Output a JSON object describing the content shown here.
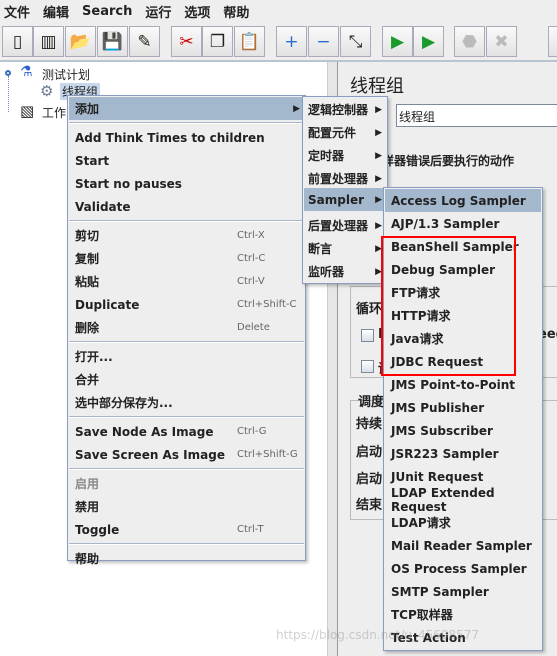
{
  "menubar": [
    "文件",
    "编辑",
    "Search",
    "运行",
    "选项",
    "帮助"
  ],
  "toolbar": [
    {
      "icon": "new-icon",
      "glyph": "▯"
    },
    {
      "icon": "templates-icon",
      "glyph": "▥"
    },
    {
      "icon": "open-icon",
      "glyph": "📂"
    },
    {
      "icon": "save-icon",
      "glyph": "💾"
    },
    {
      "icon": "save-as-icon",
      "glyph": "✎"
    },
    {
      "icon": "cut-icon",
      "glyph": "✂"
    },
    {
      "icon": "copy-icon",
      "glyph": "❐"
    },
    {
      "icon": "paste-icon",
      "glyph": "📋"
    },
    {
      "icon": "expand-icon",
      "glyph": "+"
    },
    {
      "icon": "collapse-icon",
      "glyph": "−"
    },
    {
      "icon": "toggle-icon",
      "glyph": "⤡"
    },
    {
      "icon": "start-icon",
      "glyph": "▶"
    },
    {
      "icon": "start-no-pauses-icon",
      "glyph": "▶"
    },
    {
      "icon": "stop-icon",
      "glyph": "⬣"
    },
    {
      "icon": "shutdown-icon",
      "glyph": "✖"
    }
  ],
  "tree": {
    "root": "测试计划",
    "thread_group": "线程组",
    "workbench": "工作台"
  },
  "right": {
    "title": "线程组",
    "name_value": "线程组",
    "error_action": "样器错误后要执行的动作",
    "loop": "循环",
    "check1": "D",
    "check1_tail": "eed",
    "check2": "调",
    "scheduler": "调度",
    "duration": "持续",
    "startup_delay": "启动",
    "start_time": "启动",
    "end_time": "结束"
  },
  "context_menu": {
    "items": [
      {
        "label": "添加",
        "submenu": true,
        "highlight": true
      },
      {
        "sep": true
      },
      {
        "label": "Add Think Times to children"
      },
      {
        "label": "Start"
      },
      {
        "label": "Start no pauses"
      },
      {
        "label": "Validate"
      },
      {
        "sep": true
      },
      {
        "label": "剪切",
        "shortcut": "Ctrl-X"
      },
      {
        "label": "复制",
        "shortcut": "Ctrl-C"
      },
      {
        "label": "粘贴",
        "shortcut": "Ctrl-V"
      },
      {
        "label": "Duplicate",
        "shortcut": "Ctrl+Shift-C"
      },
      {
        "label": "删除",
        "shortcut": "Delete"
      },
      {
        "sep": true
      },
      {
        "label": "打开..."
      },
      {
        "label": "合并"
      },
      {
        "label": "选中部分保存为..."
      },
      {
        "sep": true
      },
      {
        "label": "Save Node As Image",
        "shortcut": "Ctrl-G"
      },
      {
        "label": "Save Screen As Image",
        "shortcut": "Ctrl+Shift-G"
      },
      {
        "sep": true
      },
      {
        "label": "启用",
        "disabled": true
      },
      {
        "label": "禁用"
      },
      {
        "label": "Toggle",
        "shortcut": "Ctrl-T"
      },
      {
        "sep": true
      },
      {
        "label": "帮助"
      }
    ]
  },
  "add_submenu": {
    "items": [
      {
        "label": "逻辑控制器"
      },
      {
        "label": "配置元件"
      },
      {
        "label": "定时器"
      },
      {
        "label": "前置处理器"
      },
      {
        "label": "Sampler",
        "highlight": true
      },
      {
        "label": "后置处理器"
      },
      {
        "label": "断言"
      },
      {
        "label": "监听器"
      }
    ]
  },
  "sampler_submenu": {
    "items": [
      "Access Log Sampler",
      "AJP/1.3 Sampler",
      "BeanShell Sampler",
      "Debug Sampler",
      "FTP请求",
      "HTTP请求",
      "Java请求",
      "JDBC Request",
      "JMS Point-to-Point",
      "JMS Publisher",
      "JMS Subscriber",
      "JSR223 Sampler",
      "JUnit Request",
      "LDAP Extended Request",
      "LDAP请求",
      "Mail Reader Sampler",
      "OS Process Sampler",
      "SMTP Sampler",
      "TCP取样器",
      "Test Action"
    ],
    "highlighted": "Access Log Sampler",
    "boxed": [
      "BeanShell Sampler",
      "Debug Sampler",
      "FTP请求",
      "HTTP请求",
      "Java请求",
      "JDBC Request"
    ],
    "box_color": "#ff0000"
  },
  "watermark": "https://blog.csdn.net/u_45608577"
}
